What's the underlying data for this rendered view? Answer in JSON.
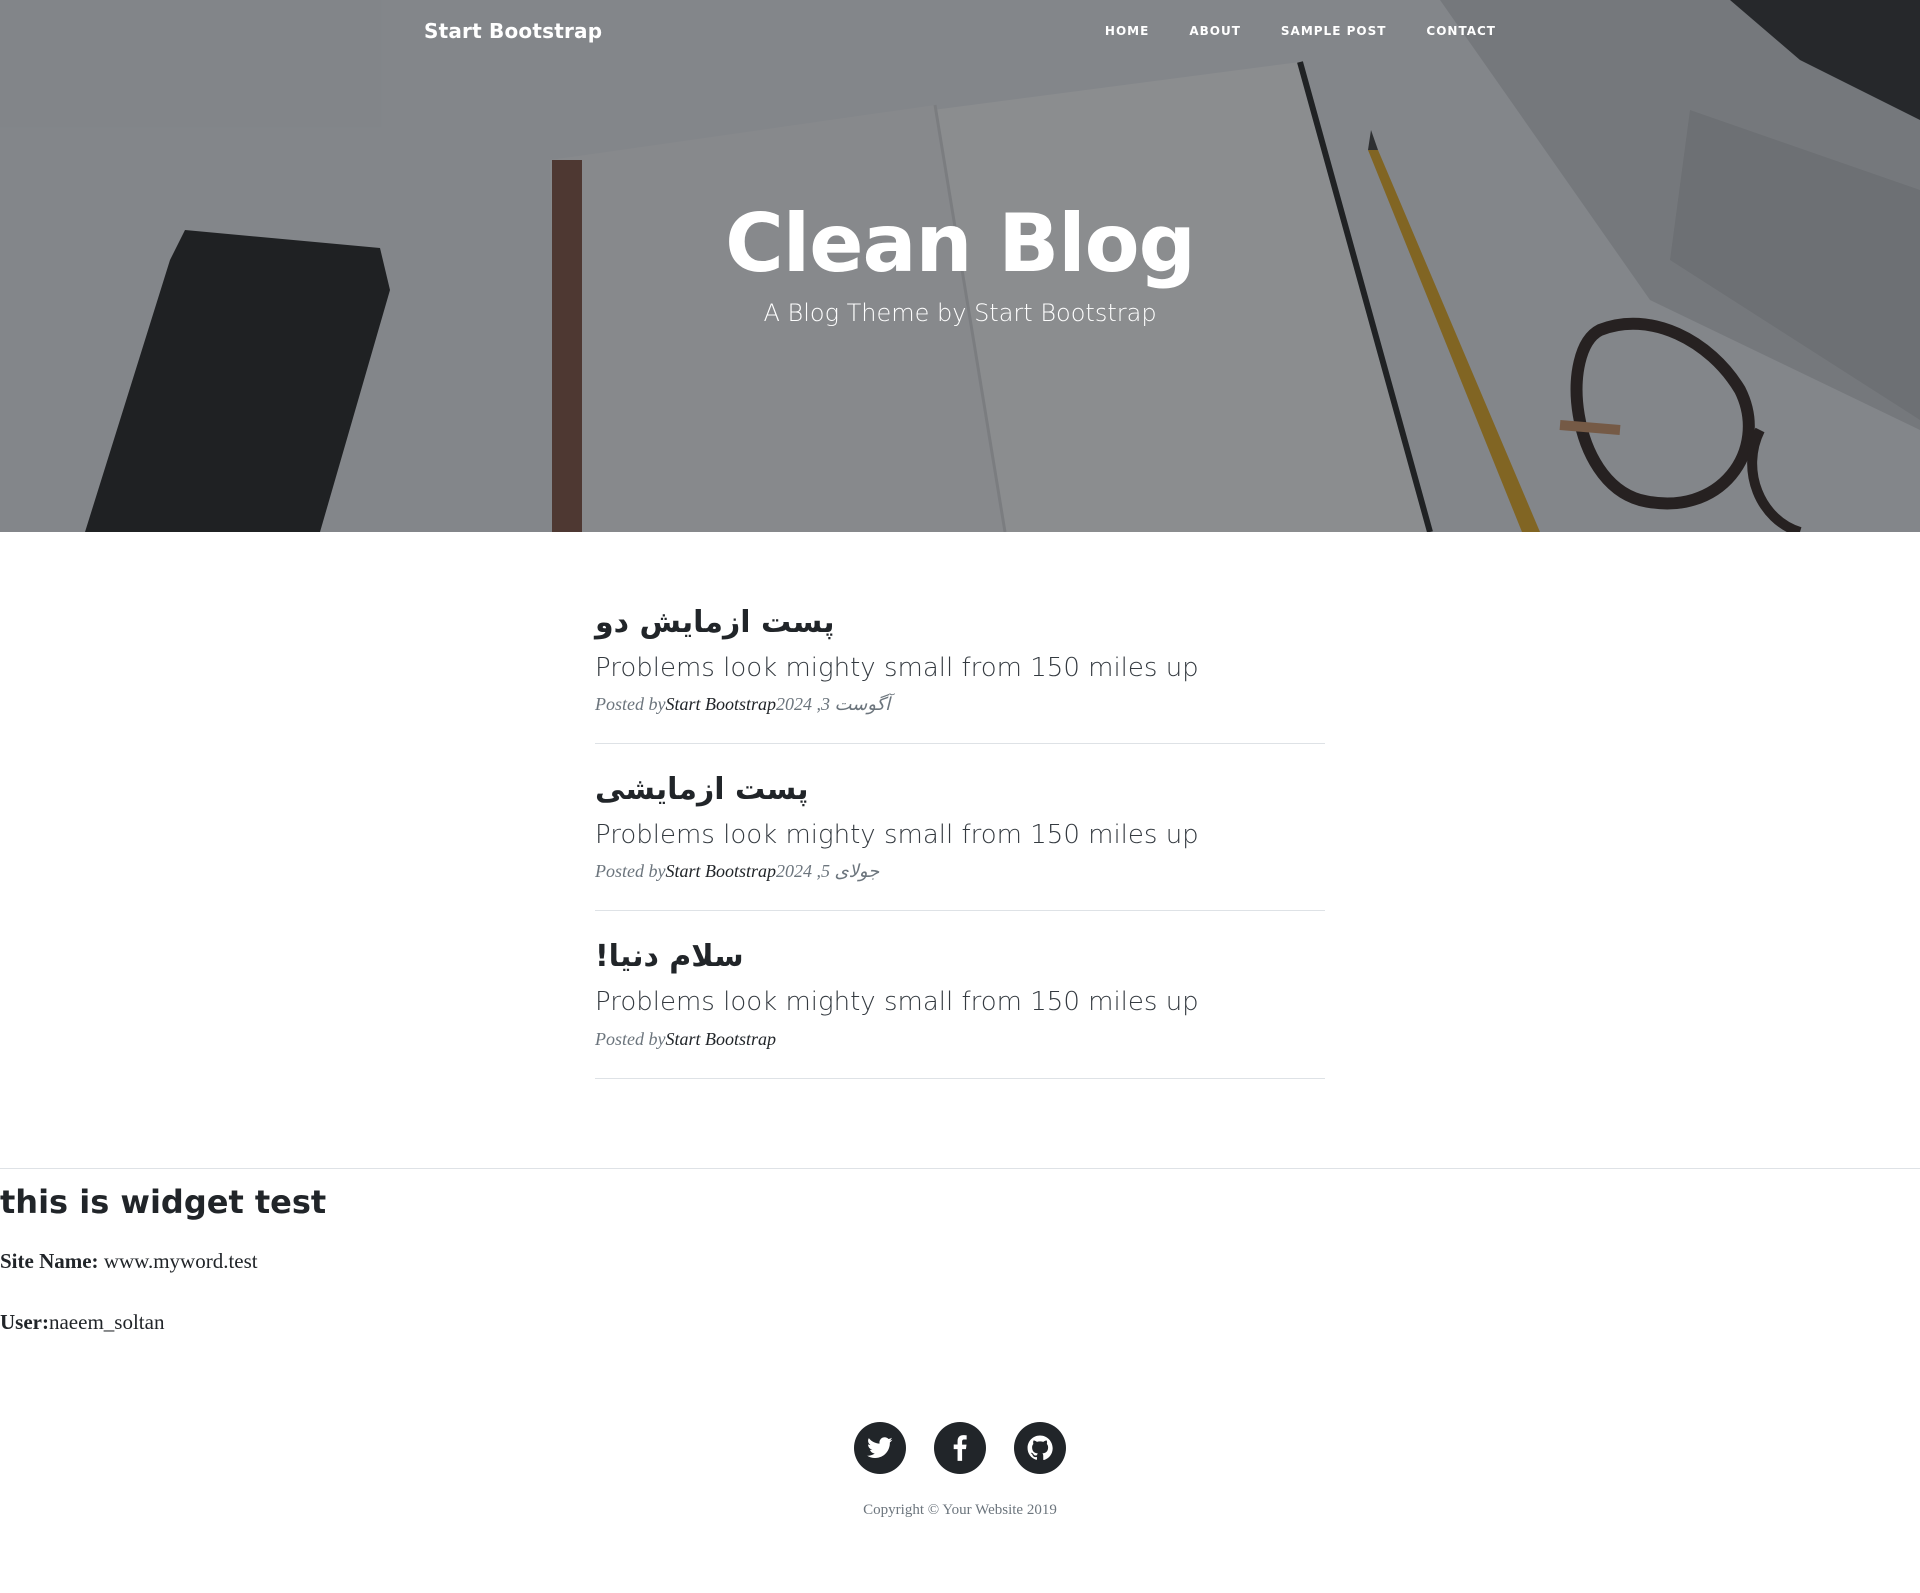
{
  "nav": {
    "brand": "Start Bootstrap",
    "links": [
      "HOME",
      "ABOUT",
      "SAMPLE POST",
      "CONTACT"
    ]
  },
  "hero": {
    "title": "Clean Blog",
    "subtitle": "A Blog Theme by Start Bootstrap"
  },
  "posts": [
    {
      "title": "پست ازمایش دو",
      "subtitle": "Problems look mighty small from 150 miles up",
      "meta_prefix": "Posted by",
      "author": "Start Bootstrap",
      "date": "آگوست 3, 2024"
    },
    {
      "title": "پست ازمایشی",
      "subtitle": "Problems look mighty small from 150 miles up",
      "meta_prefix": "Posted by",
      "author": "Start Bootstrap",
      "date": "جولای 5, 2024"
    },
    {
      "title": "سلام دنیا!",
      "subtitle": "Problems look mighty small from 150 miles up",
      "meta_prefix": "Posted by",
      "author": "Start Bootstrap",
      "date": ""
    }
  ],
  "widget": {
    "title": "this is widget test",
    "site_label": "Site Name:",
    "site_value": " www.myword.test",
    "user_label": "User:",
    "user_value": "naeem_soltan"
  },
  "footer": {
    "social": [
      "twitter-icon",
      "facebook-icon",
      "github-icon"
    ],
    "copyright": "Copyright © Your Website 2019"
  }
}
